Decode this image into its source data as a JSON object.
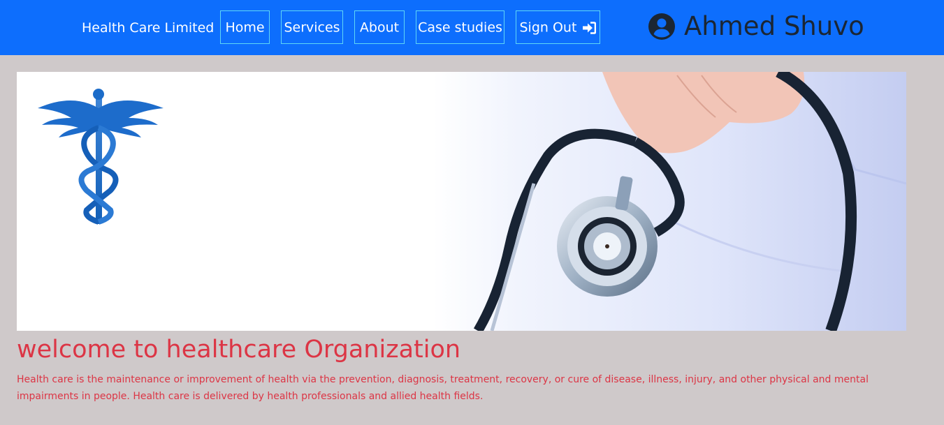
{
  "navbar": {
    "brand": "Health Care Limited",
    "items": [
      {
        "label": "Home"
      },
      {
        "label": "Services"
      },
      {
        "label": "About"
      },
      {
        "label": "Case studies"
      },
      {
        "label": "Sign Out",
        "icon": "sign-in-alt-icon"
      }
    ],
    "user": {
      "icon": "user-circle-icon",
      "name": "Ahmed Shuvo"
    }
  },
  "banner": {
    "alt": "caduceus-logo and doctor-with-stethoscope"
  },
  "main": {
    "heading": "welcome to healthcare Organization",
    "description": "Health care is the maintenance or improvement of health via the prevention, diagnosis, treatment, recovery, or cure of disease, illness, injury, and other physical and mental impairments in people. Health care is delivered by health professionals and allied health fields."
  },
  "colors": {
    "navbar": "#0d6efd",
    "background": "#cfc9ca",
    "heading": "#dc3545",
    "nav_border": "#5fd7f5"
  }
}
